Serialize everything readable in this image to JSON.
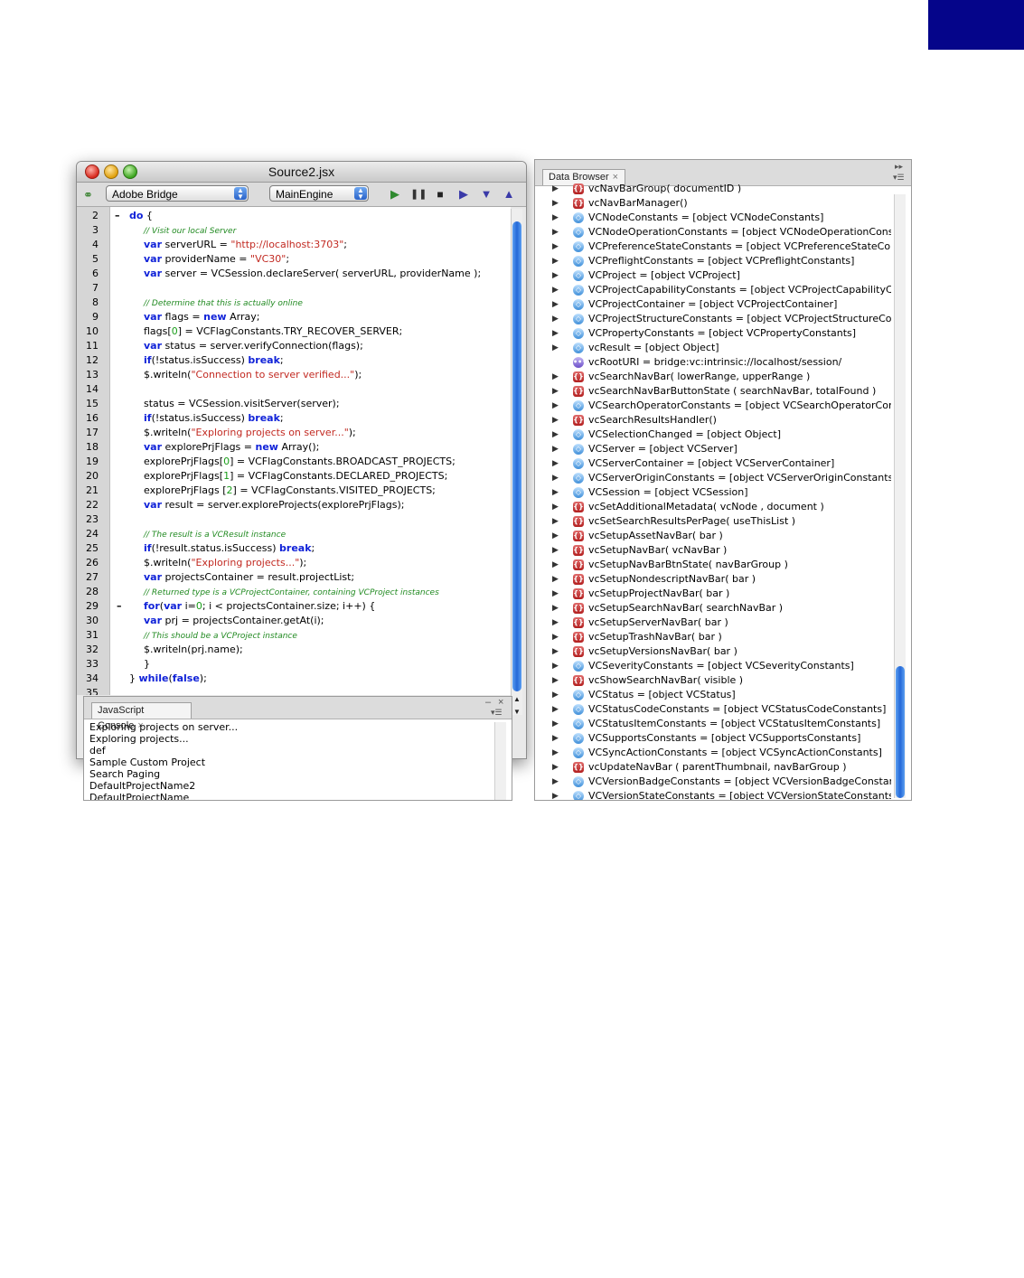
{
  "editor": {
    "title": "Source2.jsx",
    "target_app": "Adobe Bridge",
    "engine": "MainEngine",
    "lines": [
      {
        "n": "2",
        "fold": "–",
        "indent": 0,
        "html": "<span class='kw'>do</span> {"
      },
      {
        "n": "3",
        "fold": "",
        "indent": 1,
        "html": "<span class='cm'>// Visit our local Server</span>"
      },
      {
        "n": "4",
        "fold": "",
        "indent": 1,
        "html": "<span class='kw'>var</span> serverURL = <span class='str'>\"http://localhost:3703\"</span>;"
      },
      {
        "n": "5",
        "fold": "",
        "indent": 1,
        "html": "<span class='kw'>var</span> providerName = <span class='str'>\"VC30\"</span>;"
      },
      {
        "n": "6",
        "fold": "",
        "indent": 1,
        "html": "<span class='kw'>var</span> server = VCSession.declareServer( serverURL, providerName );"
      },
      {
        "n": "7",
        "fold": "",
        "indent": 1,
        "html": ""
      },
      {
        "n": "8",
        "fold": "",
        "indent": 1,
        "html": "<span class='cm'>// Determine that this is actually online</span>"
      },
      {
        "n": "9",
        "fold": "",
        "indent": 1,
        "html": "<span class='kw'>var</span> flags = <span class='kw'>new</span> Array;"
      },
      {
        "n": "10",
        "fold": "",
        "indent": 1,
        "html": "flags[<span class='num'>0</span>] = VCFlagConstants.TRY_RECOVER_SERVER;"
      },
      {
        "n": "11",
        "fold": "",
        "indent": 1,
        "html": "<span class='kw'>var</span> status = server.verifyConnection(flags);"
      },
      {
        "n": "12",
        "fold": "",
        "indent": 1,
        "html": "<span class='kw'>if</span>(!status.isSuccess) <span class='kw'>break</span>;"
      },
      {
        "n": "13",
        "fold": "",
        "indent": 1,
        "html": "$.writeln(<span class='str'>\"Connection to server verified...\"</span>);"
      },
      {
        "n": "14",
        "fold": "",
        "indent": 1,
        "html": ""
      },
      {
        "n": "15",
        "fold": "",
        "indent": 1,
        "html": "status = VCSession.visitServer(server);"
      },
      {
        "n": "16",
        "fold": "",
        "indent": 1,
        "html": "<span class='kw'>if</span>(!status.isSuccess) <span class='kw'>break</span>;"
      },
      {
        "n": "17",
        "fold": "",
        "indent": 1,
        "html": "$.writeln(<span class='str'>\"Exploring projects on server...\"</span>);"
      },
      {
        "n": "18",
        "fold": "",
        "indent": 1,
        "html": "<span class='kw'>var</span> explorePrjFlags = <span class='kw'>new</span> Array();"
      },
      {
        "n": "19",
        "fold": "",
        "indent": 1,
        "html": "explorePrjFlags[<span class='num'>0</span>] = VCFlagConstants.BROADCAST_PROJECTS;"
      },
      {
        "n": "20",
        "fold": "",
        "indent": 1,
        "html": "explorePrjFlags[<span class='num'>1</span>] = VCFlagConstants.DECLARED_PROJECTS;"
      },
      {
        "n": "21",
        "fold": "",
        "indent": 1,
        "html": "explorePrjFlags [<span class='num'>2</span>] = VCFlagConstants.VISITED_PROJECTS;"
      },
      {
        "n": "22",
        "fold": "",
        "indent": 1,
        "html": "<span class='kw'>var</span> result = server.exploreProjects(explorePrjFlags);"
      },
      {
        "n": "23",
        "fold": "",
        "indent": 1,
        "html": ""
      },
      {
        "n": "24",
        "fold": "",
        "indent": 1,
        "html": "<span class='cm'>// The result is a VCResult instance</span>"
      },
      {
        "n": "25",
        "fold": "",
        "indent": 1,
        "html": "<span class='kw'>if</span>(!result.status.isSuccess) <span class='kw'>break</span>;"
      },
      {
        "n": "26",
        "fold": "",
        "indent": 1,
        "html": "$.writeln(<span class='str'>\"Exploring projects...\"</span>);"
      },
      {
        "n": "27",
        "fold": "",
        "indent": 1,
        "html": "<span class='kw'>var</span> projectsContainer = result.projectList;"
      },
      {
        "n": "28",
        "fold": "",
        "indent": 1,
        "html": "<span class='cm'>// Returned type is a VCProjectContainer, containing VCProject instances</span>"
      },
      {
        "n": "29",
        "fold": "–",
        "indent": 1,
        "html": "<span class='kw'>for</span>(<span class='kw'>var</span> i=<span class='num'>0</span>; i &lt; projectsContainer.size; i++) {"
      },
      {
        "n": "30",
        "fold": "",
        "indent": 1,
        "html": "<span class='kw'>var</span> prj = projectsContainer.getAt(i);"
      },
      {
        "n": "31",
        "fold": "",
        "indent": 1,
        "html": "<span class='cm'>// This should be a VCProject instance</span>"
      },
      {
        "n": "32",
        "fold": "",
        "indent": 1,
        "html": "$.writeln(prj.name);"
      },
      {
        "n": "33",
        "fold": "",
        "indent": 1,
        "html": "}"
      },
      {
        "n": "34",
        "fold": "",
        "indent": 0,
        "html": "} <span class='kw'>while</span>(<span class='kw'>false</span>);"
      },
      {
        "n": "35",
        "fold": "",
        "indent": 0,
        "html": ""
      }
    ]
  },
  "console": {
    "tab_label": "JavaScript Console",
    "lines": [
      "Exploring projects on server...",
      "Exploring projects...",
      "def",
      "Sample Custom Project",
      "Search Paging",
      "DefaultProjectName2",
      "DefaultProjectName"
    ]
  },
  "browser": {
    "tab_label": "Data Browser",
    "rows": [
      {
        "icon": "func",
        "tri": true,
        "text": "vcNavBarGroup( documentID )"
      },
      {
        "icon": "func",
        "tri": true,
        "text": "vcNavBarManager()"
      },
      {
        "icon": "obj",
        "tri": true,
        "text": "VCNodeConstants = [object VCNodeConstants]"
      },
      {
        "icon": "obj",
        "tri": true,
        "text": "VCNodeOperationConstants = [object VCNodeOperationConst"
      },
      {
        "icon": "obj",
        "tri": true,
        "text": "VCPreferenceStateConstants = [object VCPreferenceStateCons"
      },
      {
        "icon": "obj",
        "tri": true,
        "text": "VCPreflightConstants = [object VCPreflightConstants]"
      },
      {
        "icon": "obj",
        "tri": true,
        "text": "VCProject = [object VCProject]"
      },
      {
        "icon": "obj",
        "tri": true,
        "text": "VCProjectCapabilityConstants = [object VCProjectCapabilityCo"
      },
      {
        "icon": "obj",
        "tri": true,
        "text": "VCProjectContainer = [object VCProjectContainer]"
      },
      {
        "icon": "obj",
        "tri": true,
        "text": "VCProjectStructureConstants = [object VCProjectStructureCon"
      },
      {
        "icon": "obj",
        "tri": true,
        "text": "VCPropertyConstants = [object VCPropertyConstants]"
      },
      {
        "icon": "obj",
        "tri": true,
        "text": "vcResult = [object Object]"
      },
      {
        "icon": "str",
        "tri": false,
        "text": "vcRootURI = bridge:vc:intrinsic://localhost/session/"
      },
      {
        "icon": "func",
        "tri": true,
        "text": "vcSearchNavBar( lowerRange, upperRange )"
      },
      {
        "icon": "func",
        "tri": true,
        "text": "vcSearchNavBarButtonState ( searchNavBar, totalFound )"
      },
      {
        "icon": "obj",
        "tri": true,
        "text": "VCSearchOperatorConstants = [object VCSearchOperatorConst"
      },
      {
        "icon": "func",
        "tri": true,
        "text": "vcSearchResultsHandler()"
      },
      {
        "icon": "obj",
        "tri": true,
        "text": "VCSelectionChanged = [object Object]"
      },
      {
        "icon": "obj",
        "tri": true,
        "text": "VCServer = [object VCServer]"
      },
      {
        "icon": "obj",
        "tri": true,
        "text": "VCServerContainer = [object VCServerContainer]"
      },
      {
        "icon": "obj",
        "tri": true,
        "text": "VCServerOriginConstants = [object VCServerOriginConstants]"
      },
      {
        "icon": "obj",
        "tri": true,
        "text": "VCSession = [object VCSession]"
      },
      {
        "icon": "func",
        "tri": true,
        "text": "vcSetAdditionalMetadata( vcNode , document )"
      },
      {
        "icon": "func",
        "tri": true,
        "text": "vcSetSearchResultsPerPage( useThisList )"
      },
      {
        "icon": "func",
        "tri": true,
        "text": "vcSetupAssetNavBar( bar )"
      },
      {
        "icon": "func",
        "tri": true,
        "text": "vcSetupNavBar( vcNavBar )"
      },
      {
        "icon": "func",
        "tri": true,
        "text": "vcSetupNavBarBtnState( navBarGroup )"
      },
      {
        "icon": "func",
        "tri": true,
        "text": "vcSetupNondescriptNavBar( bar )"
      },
      {
        "icon": "func",
        "tri": true,
        "text": "vcSetupProjectNavBar( bar )"
      },
      {
        "icon": "func",
        "tri": true,
        "text": "vcSetupSearchNavBar( searchNavBar )"
      },
      {
        "icon": "func",
        "tri": true,
        "text": "vcSetupServerNavBar( bar )"
      },
      {
        "icon": "func",
        "tri": true,
        "text": "vcSetupTrashNavBar( bar )"
      },
      {
        "icon": "func",
        "tri": true,
        "text": "vcSetupVersionsNavBar( bar )"
      },
      {
        "icon": "obj",
        "tri": true,
        "text": "VCSeverityConstants = [object VCSeverityConstants]"
      },
      {
        "icon": "func",
        "tri": true,
        "text": "vcShowSearchNavBar( visible )"
      },
      {
        "icon": "obj",
        "tri": true,
        "text": "VCStatus = [object VCStatus]"
      },
      {
        "icon": "obj",
        "tri": true,
        "text": "VCStatusCodeConstants = [object VCStatusCodeConstants]"
      },
      {
        "icon": "obj",
        "tri": true,
        "text": "VCStatusItemConstants = [object VCStatusItemConstants]"
      },
      {
        "icon": "obj",
        "tri": true,
        "text": "VCSupportsConstants = [object VCSupportsConstants]"
      },
      {
        "icon": "obj",
        "tri": true,
        "text": "VCSyncActionConstants = [object VCSyncActionConstants]"
      },
      {
        "icon": "func",
        "tri": true,
        "text": "vcUpdateNavBar ( parentThumbnail, navBarGroup )"
      },
      {
        "icon": "obj",
        "tri": true,
        "text": "VCVersionBadgeConstants = [object VCVersionBadgeConstant"
      },
      {
        "icon": "obj",
        "tri": true,
        "text": "VCVersionStateConstants = [object VCVersionStateConstants]"
      }
    ]
  },
  "colors": {
    "corner_block": "#05058a",
    "keyword": "#1022d8",
    "string": "#c22a22",
    "comment": "#218a21"
  }
}
